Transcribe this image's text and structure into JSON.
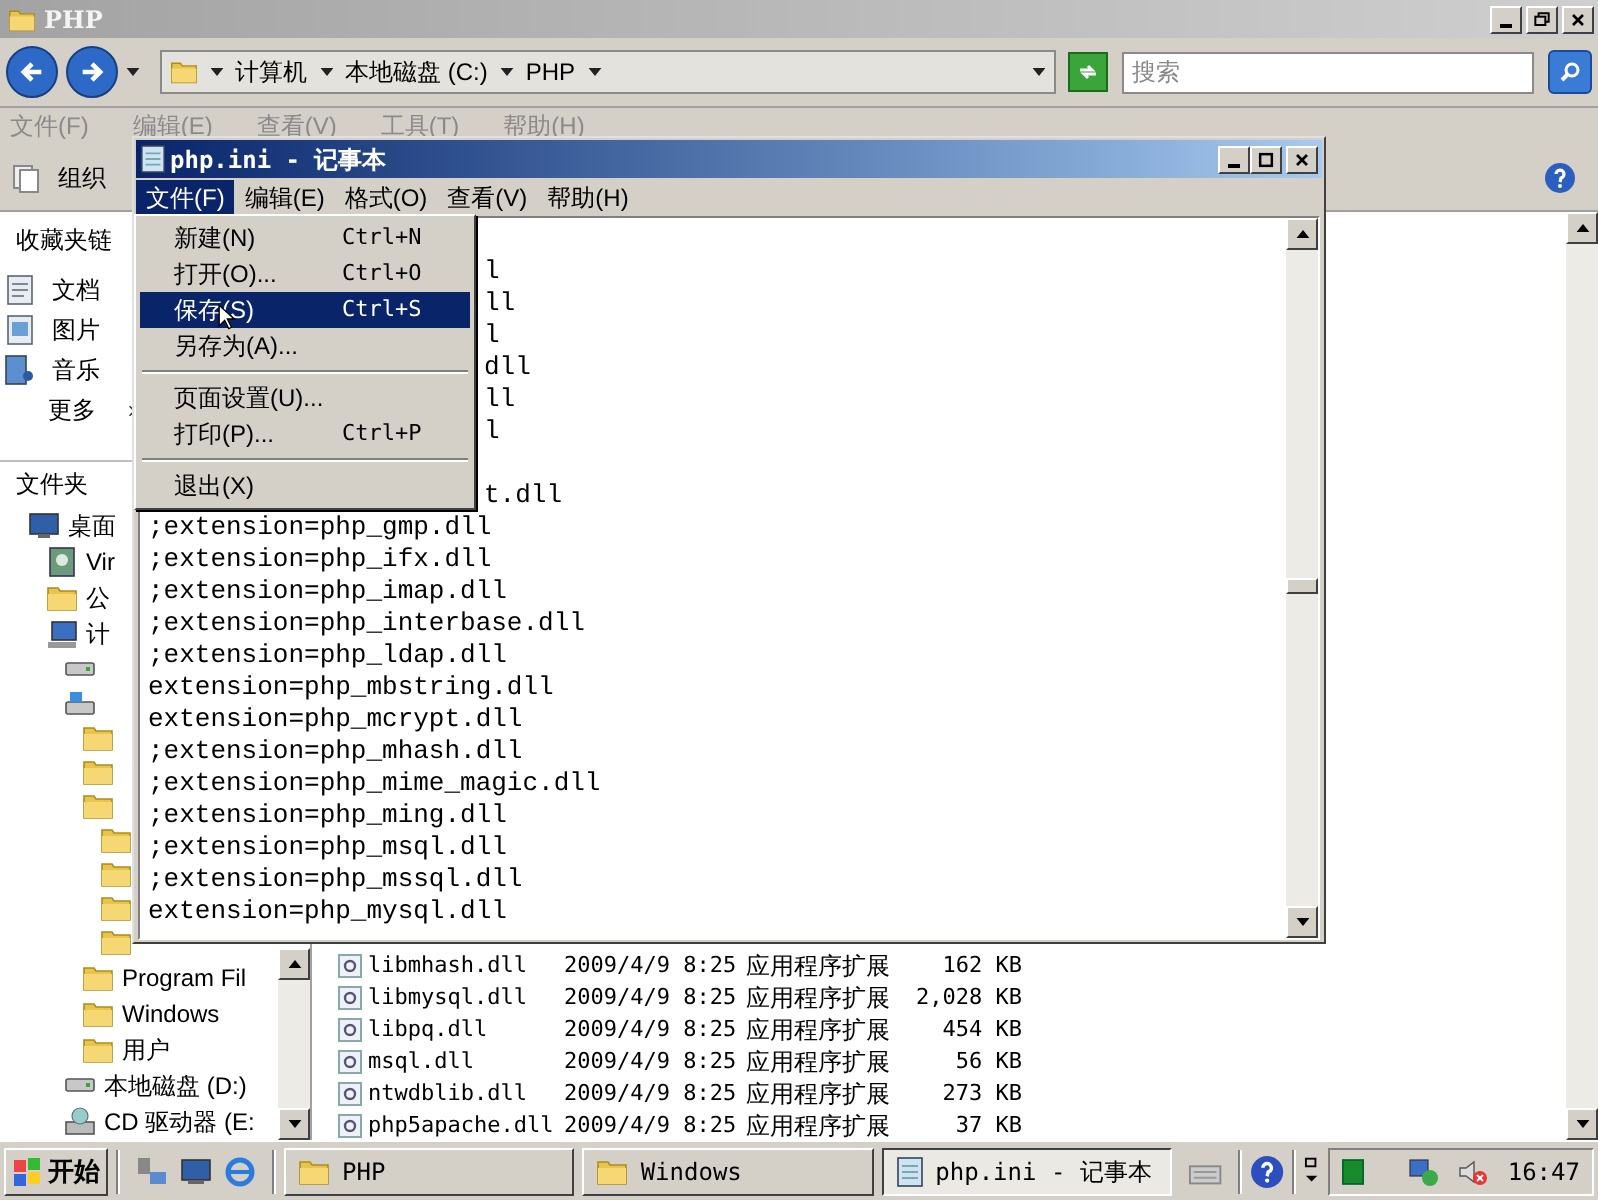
{
  "explorer": {
    "title": "PHP",
    "breadcrumb": [
      "计算机",
      "本地磁盘 (C:)",
      "PHP"
    ],
    "search": {
      "placeholder": "搜索"
    },
    "menu": [
      "文件(F)",
      "编辑(E)",
      "查看(V)",
      "工具(T)",
      "帮助(H)"
    ],
    "organize": "组织",
    "favorites_title": "收藏夹链",
    "favorites": [
      {
        "label": "文档",
        "kind": "document"
      },
      {
        "label": "图片",
        "kind": "picture"
      },
      {
        "label": "音乐",
        "kind": "music"
      },
      {
        "label": "更多",
        "kind": "more"
      }
    ],
    "folders_title": "文件夹",
    "tree": [
      {
        "label": "桌面",
        "kind": "desktop",
        "children": [
          {
            "label": "Vir",
            "kind": "user"
          },
          {
            "label": "公",
            "kind": "folder"
          },
          {
            "label": "计",
            "kind": "computer",
            "children": [
              {
                "kind": "drive"
              },
              {
                "kind": "system-drive",
                "children": [
                  {
                    "kind": "folder"
                  },
                  {
                    "kind": "folder"
                  },
                  {
                    "kind": "folder",
                    "children": [
                      {
                        "kind": "folder"
                      },
                      {
                        "kind": "folder"
                      },
                      {
                        "kind": "folder"
                      },
                      {
                        "kind": "folder"
                      }
                    ]
                  },
                  {
                    "label": "Program Fil",
                    "kind": "folder"
                  },
                  {
                    "label": "Windows",
                    "kind": "folder"
                  },
                  {
                    "label": "用户",
                    "kind": "folder"
                  }
                ]
              },
              {
                "label": "本地磁盘 (D:)",
                "kind": "drive"
              },
              {
                "label": "CD 驱动器 (E:",
                "kind": "cd"
              }
            ]
          }
        ]
      }
    ],
    "files": [
      {
        "name": "libmhash.dll",
        "date": "2009/4/9 8:25",
        "type": "应用程序扩展",
        "size": "162 KB"
      },
      {
        "name": "libmysql.dll",
        "date": "2009/4/9 8:25",
        "type": "应用程序扩展",
        "size": "2,028 KB"
      },
      {
        "name": "libpq.dll",
        "date": "2009/4/9 8:25",
        "type": "应用程序扩展",
        "size": "454 KB"
      },
      {
        "name": "msql.dll",
        "date": "2009/4/9 8:25",
        "type": "应用程序扩展",
        "size": "56 KB"
      },
      {
        "name": "ntwdblib.dll",
        "date": "2009/4/9 8:25",
        "type": "应用程序扩展",
        "size": "273 KB"
      },
      {
        "name": "php5apache.dll",
        "date": "2009/4/9 8:25",
        "type": "应用程序扩展",
        "size": "37 KB"
      }
    ]
  },
  "notepad": {
    "title": "php.ini - 记事本",
    "menu": [
      {
        "label": "文件(F)",
        "selected": true
      },
      {
        "label": "编辑(E)",
        "selected": false
      },
      {
        "label": "格式(O)",
        "selected": false
      },
      {
        "label": "查看(V)",
        "selected": false
      },
      {
        "label": "帮助(H)",
        "selected": false
      }
    ],
    "file_menu": [
      {
        "kind": "item",
        "label": "新建(N)",
        "shortcut": "Ctrl+N",
        "selected": false
      },
      {
        "kind": "item",
        "label": "打开(O)...",
        "shortcut": "Ctrl+O",
        "selected": false
      },
      {
        "kind": "item",
        "label": "保存(S)",
        "shortcut": "Ctrl+S",
        "selected": true
      },
      {
        "kind": "item",
        "label": "另存为(A)...",
        "selected": false
      },
      {
        "kind": "separator"
      },
      {
        "kind": "item",
        "label": "页面设置(U)...",
        "selected": false
      },
      {
        "kind": "item",
        "label": "打印(P)...",
        "shortcut": "Ctrl+P",
        "selected": false
      },
      {
        "kind": "separator"
      },
      {
        "kind": "item",
        "label": "退出(X)",
        "selected": false
      }
    ],
    "lines": [
      {
        "kind": "tail",
        "text": "l"
      },
      {
        "kind": "tail",
        "text": "ll"
      },
      {
        "kind": "tail",
        "text": "l"
      },
      {
        "kind": "tail",
        "text": "dll"
      },
      {
        "kind": "tail",
        "text": "ll"
      },
      {
        "kind": "tail",
        "text": "l"
      },
      {
        "kind": "blank"
      },
      {
        "kind": "tail",
        "text": "t.dll"
      },
      {
        "kind": "full",
        "text": ";extension=php_gmp.dll"
      },
      {
        "kind": "full",
        "text": ";extension=php_ifx.dll"
      },
      {
        "kind": "full",
        "text": ";extension=php_imap.dll"
      },
      {
        "kind": "full",
        "text": ";extension=php_interbase.dll"
      },
      {
        "kind": "full",
        "text": ";extension=php_ldap.dll"
      },
      {
        "kind": "full",
        "text": "extension=php_mbstring.dll"
      },
      {
        "kind": "full",
        "text": "extension=php_mcrypt.dll"
      },
      {
        "kind": "full",
        "text": ";extension=php_mhash.dll"
      },
      {
        "kind": "full",
        "text": ";extension=php_mime_magic.dll"
      },
      {
        "kind": "full",
        "text": ";extension=php_ming.dll"
      },
      {
        "kind": "full",
        "text": ";extension=php_msql.dll"
      },
      {
        "kind": "full",
        "text": ";extension=php_mssql.dll"
      },
      {
        "kind": "full",
        "text": "extension=php_mysql.dll"
      }
    ]
  },
  "taskbar": {
    "start": "开始",
    "tasks": [
      {
        "label": "PHP",
        "kind": "folder",
        "selected": false
      },
      {
        "label": "Windows",
        "kind": "folder",
        "selected": false
      },
      {
        "label": "php.ini - 记事本",
        "kind": "notepad",
        "selected": true
      }
    ],
    "clock": "16:47"
  }
}
